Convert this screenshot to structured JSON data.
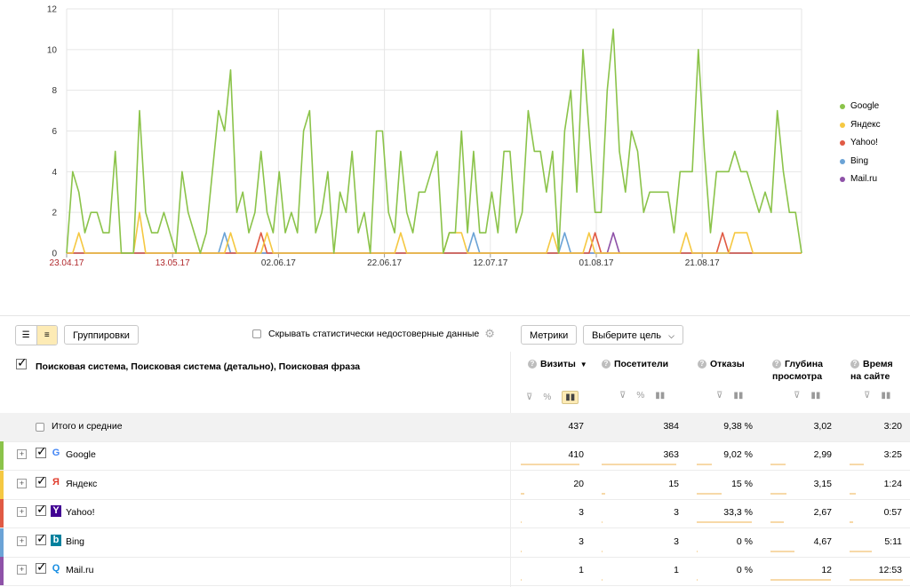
{
  "chart_data": {
    "type": "line",
    "x_ticks": [
      "23.04.17",
      "13.05.17",
      "02.06.17",
      "22.06.17",
      "12.07.17",
      "01.08.17",
      "21.08.17"
    ],
    "weekend_ticks": [
      "23.04.17",
      "13.05.17"
    ],
    "ylim": [
      0,
      12
    ],
    "y_ticks": [
      "0",
      "2",
      "4",
      "6",
      "8",
      "10",
      "12"
    ],
    "grid": true,
    "legend_position": "right",
    "series": [
      {
        "name": "Google",
        "color": "#8bc34a",
        "values": [
          0,
          4,
          3,
          1,
          2,
          2,
          1,
          1,
          5,
          0,
          0,
          0,
          7,
          2,
          1,
          1,
          2,
          1,
          0,
          4,
          2,
          1,
          0,
          1,
          4,
          7,
          6,
          9,
          2,
          3,
          1,
          2,
          5,
          2,
          1,
          4,
          1,
          2,
          1,
          6,
          7,
          1,
          2,
          4,
          0,
          3,
          2,
          5,
          1,
          2,
          0,
          6,
          6,
          2,
          1,
          5,
          2,
          1,
          3,
          3,
          4,
          5,
          0,
          1,
          1,
          6,
          1,
          5,
          1,
          1,
          3,
          1,
          5,
          5,
          1,
          2,
          7,
          5,
          5,
          3,
          5,
          0,
          6,
          8,
          3,
          10,
          6,
          2,
          2,
          8,
          11,
          5,
          3,
          6,
          5,
          2,
          3,
          3,
          3,
          3,
          1,
          4,
          4,
          4,
          10,
          5,
          1,
          4,
          4,
          4,
          5,
          4,
          4,
          3,
          2,
          3,
          2,
          7,
          4,
          2,
          2,
          0
        ]
      },
      {
        "name": "Яндекс",
        "color": "#f5c842",
        "values": [
          0,
          0,
          1,
          0,
          0,
          0,
          0,
          0,
          0,
          0,
          0,
          0,
          2,
          0,
          0,
          0,
          0,
          0,
          0,
          0,
          0,
          0,
          0,
          0,
          0,
          0,
          0,
          1,
          0,
          0,
          0,
          0,
          0,
          1,
          0,
          0,
          0,
          0,
          0,
          0,
          0,
          0,
          0,
          0,
          0,
          0,
          0,
          0,
          0,
          0,
          0,
          0,
          0,
          0,
          0,
          1,
          0,
          0,
          0,
          0,
          0,
          0,
          0,
          1,
          1,
          1,
          0,
          0,
          0,
          0,
          0,
          0,
          0,
          0,
          0,
          0,
          0,
          0,
          0,
          0,
          1,
          0,
          0,
          0,
          0,
          0,
          1,
          0,
          0,
          0,
          0,
          0,
          0,
          0,
          0,
          0,
          0,
          0,
          0,
          0,
          0,
          0,
          1,
          0,
          0,
          0,
          0,
          0,
          0,
          0,
          1,
          1,
          1,
          0,
          0,
          0,
          0,
          0,
          0,
          0,
          0,
          0
        ]
      },
      {
        "name": "Yahoo!",
        "color": "#e05a44",
        "values": [
          0,
          0,
          0,
          0,
          0,
          0,
          0,
          0,
          0,
          0,
          0,
          0,
          0,
          0,
          0,
          0,
          0,
          0,
          0,
          0,
          0,
          0,
          0,
          0,
          0,
          0,
          0,
          0,
          0,
          0,
          0,
          0,
          1,
          0,
          0,
          0,
          0,
          0,
          0,
          0,
          0,
          0,
          0,
          0,
          0,
          0,
          0,
          0,
          0,
          0,
          0,
          0,
          0,
          0,
          0,
          0,
          0,
          0,
          0,
          0,
          0,
          0,
          0,
          0,
          0,
          0,
          0,
          0,
          0,
          0,
          0,
          0,
          0,
          0,
          0,
          0,
          0,
          0,
          0,
          0,
          0,
          0,
          0,
          0,
          0,
          0,
          0,
          1,
          0,
          0,
          0,
          0,
          0,
          0,
          0,
          0,
          0,
          0,
          0,
          0,
          0,
          0,
          0,
          0,
          0,
          0,
          0,
          0,
          1,
          0,
          0,
          0,
          0,
          0,
          0,
          0,
          0,
          0,
          0,
          0,
          0,
          0
        ]
      },
      {
        "name": "Bing",
        "color": "#6ba3d6",
        "values": [
          0,
          0,
          0,
          0,
          0,
          0,
          0,
          0,
          0,
          0,
          0,
          0,
          0,
          0,
          0,
          0,
          0,
          0,
          0,
          0,
          0,
          0,
          0,
          0,
          0,
          0,
          1,
          0,
          0,
          0,
          0,
          0,
          0,
          0,
          0,
          0,
          0,
          0,
          0,
          0,
          0,
          0,
          0,
          0,
          0,
          0,
          0,
          0,
          0,
          0,
          0,
          0,
          0,
          0,
          0,
          0,
          0,
          0,
          0,
          0,
          0,
          0,
          0,
          0,
          0,
          0,
          0,
          1,
          0,
          0,
          0,
          0,
          0,
          0,
          0,
          0,
          0,
          0,
          0,
          0,
          0,
          0,
          1,
          0,
          0,
          0,
          0,
          0,
          0,
          0,
          0,
          0,
          0,
          0,
          0,
          0,
          0,
          0,
          0,
          0,
          0,
          0,
          0,
          0,
          0,
          0,
          0,
          0,
          0,
          0,
          0,
          0,
          0,
          0,
          0,
          0,
          0,
          0,
          0,
          0,
          0,
          0
        ]
      },
      {
        "name": "Mail.ru",
        "color": "#8e52a8",
        "values": [
          0,
          0,
          0,
          0,
          0,
          0,
          0,
          0,
          0,
          0,
          0,
          0,
          0,
          0,
          0,
          0,
          0,
          0,
          0,
          0,
          0,
          0,
          0,
          0,
          0,
          0,
          0,
          0,
          0,
          0,
          0,
          0,
          0,
          0,
          0,
          0,
          0,
          0,
          0,
          0,
          0,
          0,
          0,
          0,
          0,
          0,
          0,
          0,
          0,
          0,
          0,
          0,
          0,
          0,
          0,
          0,
          0,
          0,
          0,
          0,
          0,
          0,
          0,
          0,
          0,
          0,
          0,
          0,
          0,
          0,
          0,
          0,
          0,
          0,
          0,
          0,
          0,
          0,
          0,
          0,
          0,
          0,
          0,
          0,
          0,
          0,
          0,
          0,
          0,
          0,
          1,
          0,
          0,
          0,
          0,
          0,
          0,
          0,
          0,
          0,
          0,
          0,
          0,
          0,
          0,
          0,
          0,
          0,
          0,
          0,
          0,
          0,
          0,
          0,
          0,
          0,
          0,
          0,
          0,
          0,
          0,
          0
        ]
      }
    ]
  },
  "toolbar": {
    "groupings_label": "Группировки",
    "hide_unreliable_label": "Скрывать статистически недостоверные данные",
    "metrics_label": "Метрики",
    "goal_select_value": "Выберите цель"
  },
  "table": {
    "dimension_header": "Поисковая система, Поисковая система (детально), Поисковая фраза",
    "columns": [
      {
        "label": "Визиты",
        "sort": "▼"
      },
      {
        "label": "Посетители"
      },
      {
        "label": "Отказы"
      },
      {
        "label": "Глубина просмотра"
      },
      {
        "label": "Время на сайте"
      }
    ],
    "total": {
      "label": "Итого и средние",
      "values": [
        "437",
        "384",
        "9,38 %",
        "3,02",
        "3:20"
      ]
    },
    "rows": [
      {
        "label": "Google",
        "color": "#8bc34a",
        "icon": "google-icon",
        "values": [
          "410",
          "363",
          "9,02 %",
          "2,99",
          "3:25"
        ],
        "levels": [
          0.94,
          0.95,
          0.27,
          0.25,
          0.26
        ]
      },
      {
        "label": "Яндекс",
        "color": "#f5c842",
        "icon": "yandex-icon",
        "values": [
          "20",
          "15",
          "15 %",
          "3,15",
          "1:24"
        ],
        "levels": [
          0.05,
          0.04,
          0.45,
          0.26,
          0.11
        ]
      },
      {
        "label": "Yahoo!",
        "color": "#e05a44",
        "icon": "yahoo-icon",
        "values": [
          "3",
          "3",
          "33,3 %",
          "2,67",
          "0:57"
        ],
        "levels": [
          0.01,
          0.01,
          1.0,
          0.22,
          0.07
        ]
      },
      {
        "label": "Bing",
        "color": "#6ba3d6",
        "icon": "bing-icon",
        "values": [
          "3",
          "3",
          "0 %",
          "4,67",
          "5:11"
        ],
        "levels": [
          0.01,
          0.01,
          0.0,
          0.39,
          0.41
        ]
      },
      {
        "label": "Mail.ru",
        "color": "#8e52a8",
        "icon": "mailru-icon",
        "values": [
          "1",
          "1",
          "0 %",
          "12",
          "12:53"
        ],
        "levels": [
          0.0,
          0.0,
          0.0,
          1.0,
          1.0
        ]
      }
    ]
  }
}
